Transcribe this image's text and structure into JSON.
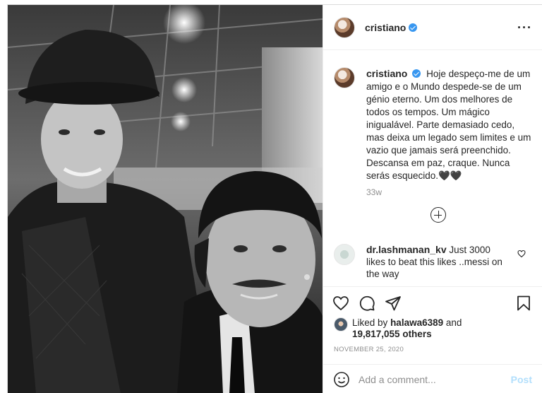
{
  "post": {
    "author": "cristiano",
    "caption": "Hoje despeço-me de um amigo e o Mundo despede-se de um génio eterno. Um dos melhores de todos os tempos. Um mágico inigualável. Parte demasiado cedo, mas deixa um legado sem limites e um vazio que jamais será preenchido. Descansa em paz, craque. Nunca serás esquecido.🖤🖤",
    "caption_age": "33w",
    "date": "NOVEMBER 25, 2020"
  },
  "comments": [
    {
      "author": "dr.lashmanan_kv",
      "text": "Just 3000 likes to beat this likes ..messi on the way"
    }
  ],
  "likes": {
    "prefix": "Liked by",
    "user": "halawa6389",
    "conjunction": "and",
    "others": "19,817,055 others"
  },
  "comment_bar": {
    "placeholder": "Add a comment...",
    "post_label": "Post"
  },
  "colors": {
    "verified": "#3897f0",
    "post_disabled": "#b2dffc",
    "text": "#262626",
    "muted": "#8e8e8e"
  }
}
